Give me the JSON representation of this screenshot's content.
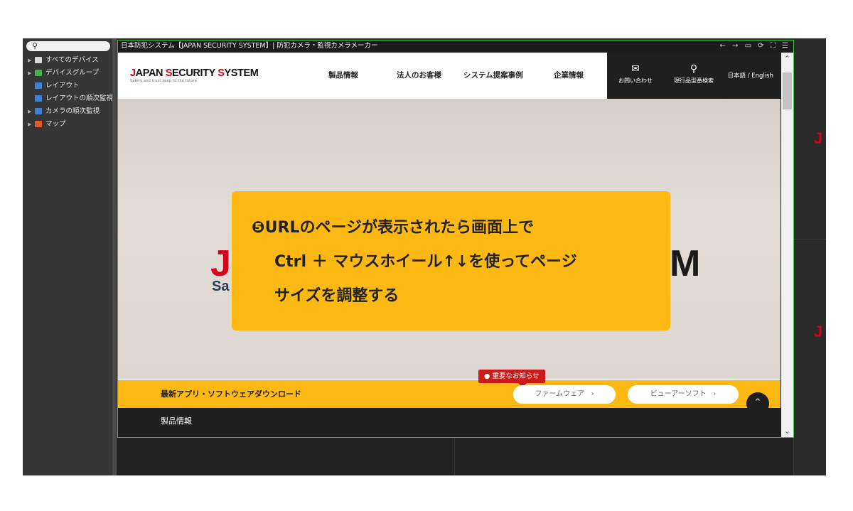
{
  "sidebar": {
    "search_icon": "search-icon",
    "items": [
      {
        "label": "すべてのデバイス",
        "icon": "device-list-icon",
        "color": "#d9d9d9"
      },
      {
        "label": "デバイスグループ",
        "icon": "device-group-icon",
        "color": "#4caf50"
      },
      {
        "label": "レイアウト",
        "icon": "layout-icon",
        "color": "#3f7fd6"
      },
      {
        "label": "レイアウトの順次監視",
        "icon": "layout-sequence-icon",
        "color": "#3f7fd6"
      },
      {
        "label": "カメラの順次監視",
        "icon": "camera-sequence-icon",
        "color": "#3f7fd6"
      },
      {
        "label": "マップ",
        "icon": "map-icon",
        "color": "#e05a2b"
      }
    ]
  },
  "browser": {
    "title": "日本防犯システム【JAPAN SECURITY SYSTEM】| 防犯カメラ・監視カメラメーカー",
    "nav_icons": "← → ▭ ⟳ ⛶ ☰"
  },
  "site": {
    "logo_red_1": "J",
    "logo_black_1": "APAN ",
    "logo_red_2": "S",
    "logo_black_2": "ECURITY ",
    "logo_red_3": "S",
    "logo_black_3": "YSTEM",
    "tagline": "Safety and trust keep to the future",
    "nav": [
      "製品情報",
      "法人のお客様",
      "システム提案事例",
      "企業情報"
    ],
    "contact_label": "お問い合わせ",
    "search_label": "現行品型番検索",
    "lang": "日本語 / English",
    "hero_letter_left": "J",
    "hero_sub_left": "Sa",
    "hero_letter_right": "M",
    "notice_badge": "重要なお知らせ",
    "download_label": "最新アプリ・ソフトウェアダウンロード",
    "firmware_label": "ファームウェア",
    "viewer_label": "ビューアーソフト",
    "product_bar_label": "製品情報"
  },
  "callout": {
    "number": "❺",
    "line1": "URLのページが表示されたら画面上で",
    "line2": "Ctrl ＋ マウスホイール↑↓を使ってページ",
    "line3": "サイズを調整する"
  },
  "right_panel": {
    "letter_top": "J",
    "letter_bottom": "J"
  },
  "colors": {
    "accent_yellow": "#fdb913",
    "brand_red": "#d6001c",
    "frame_green": "#3ac63a"
  }
}
